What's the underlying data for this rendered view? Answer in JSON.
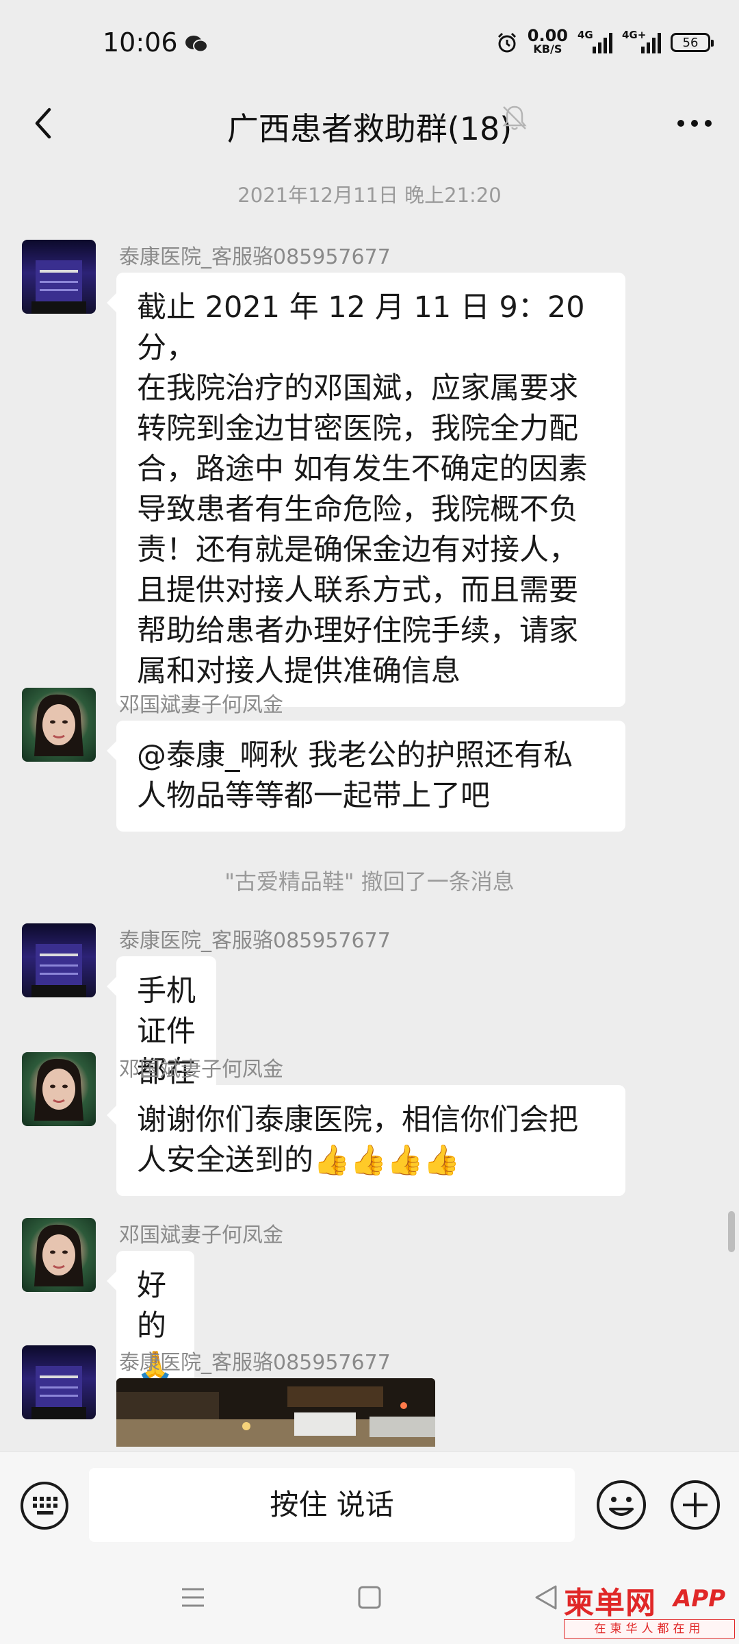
{
  "status_bar": {
    "time": "10:06",
    "net_speed_value": "0.00",
    "net_speed_unit": "KB/S",
    "signal1_label": "4G",
    "signal2_label": "4G+",
    "battery": "56"
  },
  "header": {
    "title": "广西患者救助群(18)"
  },
  "chat": {
    "timestamp": "2021年12月11日 晚上21:20",
    "messages": [
      {
        "sender": "泰康医院_客服骆085957677",
        "lines": [
          "截止 2021 年 12 月 11 日 9：20 分，",
          "在我院治疗的邓国斌，应家属要求",
          "转院到金边甘密医院，我院全力配",
          "合，路途中 如有发生不确定的因素",
          "导致患者有生命危险，我院概不负",
          "责！还有就是确保金边有对接人，",
          "且提供对接人联系方式，而且需要",
          "帮助给患者办理好住院手续，请家",
          "属和对接人提供准确信息"
        ]
      },
      {
        "sender": "邓国斌妻子何凤金",
        "lines": [
          "@泰康_啊秋  我老公的护照还有私",
          "人物品等等都一起带上了吧"
        ]
      },
      {
        "sender": "泰康医院_客服骆085957677",
        "lines": [
          "手机证件都在的，"
        ]
      },
      {
        "sender": "邓国斌妻子何凤金",
        "lines": [
          "谢谢你们泰康医院，相信你们会把",
          "人安全送到的👍👍👍👍"
        ]
      },
      {
        "sender": "邓国斌妻子何凤金",
        "lines": [
          "好的🙏🙏"
        ]
      },
      {
        "sender": "泰康医院_客服骆085957677"
      }
    ],
    "recall_notice": "\"古爱精品鞋\" 撤回了一条消息"
  },
  "input_bar": {
    "voice_label": "按住 说话"
  },
  "watermark": {
    "logo": "柬单网",
    "app": "APP",
    "slogan": "在柬华人都在用"
  },
  "icons": {
    "back": "chevron-left-icon",
    "mute": "mute-bell-icon",
    "more": "more-dots-icon",
    "keyboard": "keyboard-icon",
    "emoji": "emoji-icon",
    "plus": "plus-icon"
  },
  "colors": {
    "background": "#ededed",
    "bubble": "#ffffff",
    "meta_text": "#9a9a9a",
    "watermark_red": "#e02727"
  }
}
